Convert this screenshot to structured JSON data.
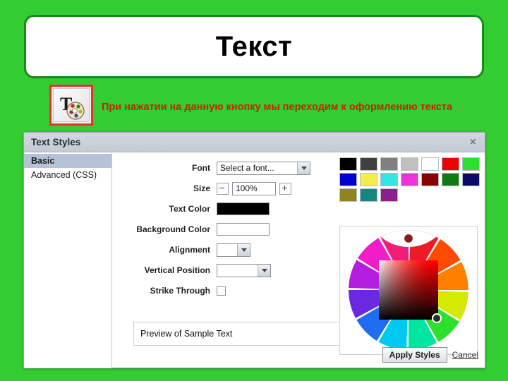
{
  "slide": {
    "background_color": "#33cc33",
    "title": "Текст",
    "annotation": "При нажатии на данную кнопку мы переходим к оформлению текста",
    "annotation_color": "#cc2200",
    "button_thumb": {
      "icon": "text-styles-palette-icon",
      "highlight_color": "#e8312a"
    }
  },
  "dialog": {
    "title": "Text Styles",
    "close_label": "×",
    "nav": {
      "items": [
        {
          "label": "Basic",
          "active": true
        },
        {
          "label": "Advanced (CSS)",
          "active": false
        }
      ]
    },
    "form": {
      "font": {
        "label": "Font",
        "value": "Select a font...",
        "icon": "chevron-down-icon"
      },
      "size": {
        "label": "Size",
        "value": "100%",
        "decrement_icon": "minus-icon",
        "increment_icon": "plus-icon"
      },
      "text_color": {
        "label": "Text Color",
        "value": "#000000"
      },
      "background_color": {
        "label": "Background Color",
        "value": ""
      },
      "alignment": {
        "label": "Alignment",
        "value": "",
        "icon": "chevron-down-icon"
      },
      "vertical_position": {
        "label": "Vertical Position",
        "value": "",
        "icon": "chevron-down-icon"
      },
      "strike_through": {
        "label": "Strike Through",
        "checked": false
      }
    },
    "preview": {
      "text": "Preview of Sample Text"
    },
    "palette": {
      "swatches": [
        "#000000",
        "#404040",
        "#808080",
        "#c0c0c0",
        "#ffffff",
        "#ee0000",
        "#2ee02e",
        "#0000cc",
        "#f5ee4a",
        "#33e6e6",
        "#ee33dd",
        "#8b0000",
        "#137a13",
        "#0a0a66",
        "#8f8420",
        "#16857f",
        "#8c1f8c"
      ]
    },
    "color_wheel": {
      "name": "hue-ring-with-sv-square",
      "hue_marker_color": "#8b1818",
      "sv_marker_color": "#111111"
    },
    "footer": {
      "apply_label": "Apply Styles",
      "cancel_label": "Cancel"
    }
  }
}
